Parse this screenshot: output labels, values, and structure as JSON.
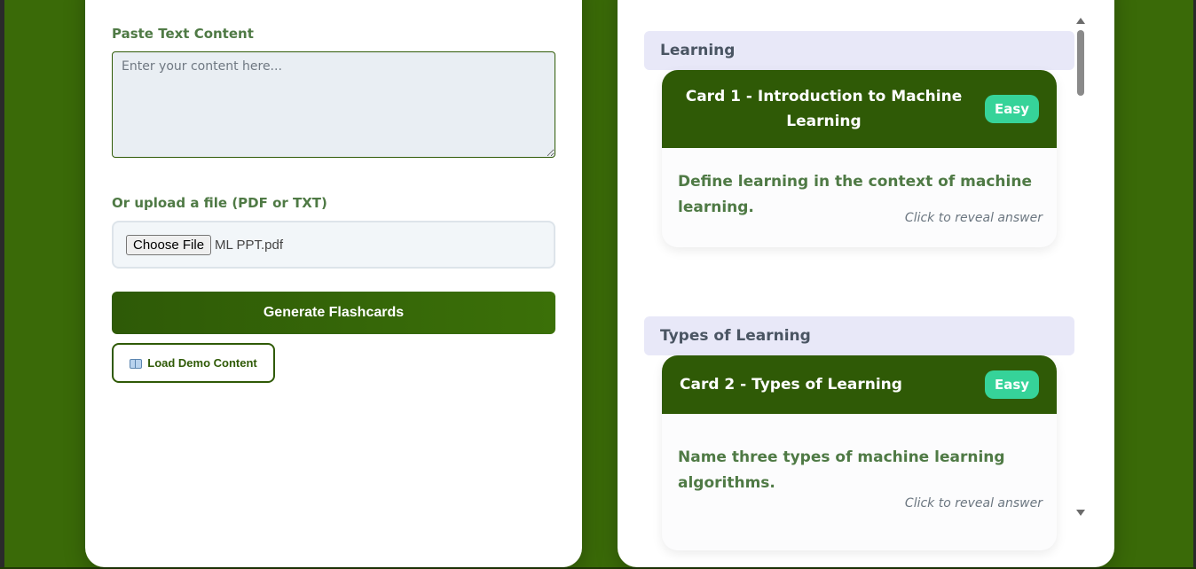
{
  "input_panel": {
    "paste_label": "Paste Text Content",
    "textarea_placeholder": "Enter your content here...",
    "upload_label": "Or upload a file (PDF or TXT)",
    "choose_file_label": "Choose File",
    "file_name": "ML PPT.pdf",
    "generate_label": "Generate Flashcards",
    "demo_label": "Load Demo Content",
    "demo_icon": "book-icon"
  },
  "flashcards": {
    "sections": [
      {
        "title": "Learning",
        "card": {
          "title_line1": "Card 1 - Introduction to Machine",
          "title_line2": "Learning",
          "difficulty": "Easy",
          "question_line1": "Define learning in the context of machine",
          "question_line2": "learning.",
          "hint": "Click to reveal answer"
        }
      },
      {
        "title": "Types of Learning",
        "card": {
          "title_line1": "Card 2 - Types of Learning",
          "difficulty": "Easy",
          "question_line1": "Name three types of machine learning",
          "question_line2": "algorithms.",
          "hint": "Click to reveal answer"
        }
      }
    ]
  },
  "colors": {
    "background": "#3a6a08",
    "primary": "#2f5a06",
    "badge": "#36d399",
    "section_bg": "#e8e8f8"
  }
}
